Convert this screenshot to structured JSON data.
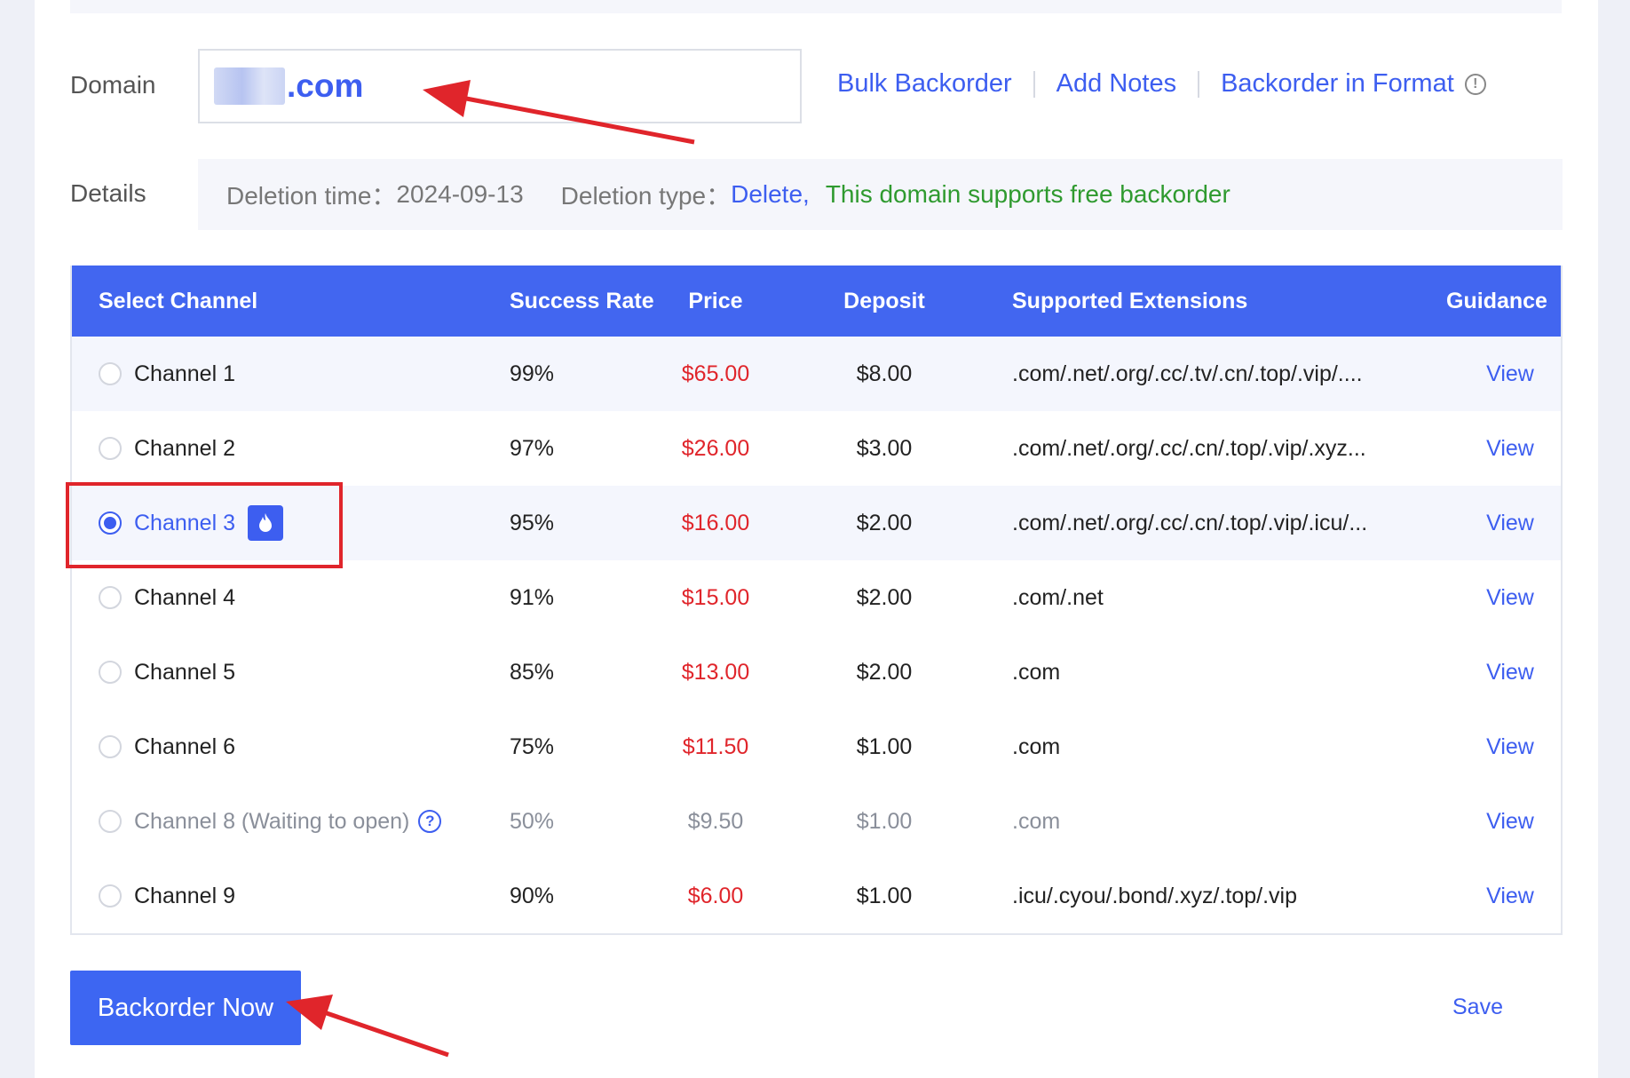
{
  "form": {
    "domain_label": "Domain",
    "domain_ext": ".com",
    "details_label": "Details",
    "links": [
      "Bulk Backorder",
      "Add Notes",
      "Backorder in Format"
    ]
  },
  "details": {
    "deletion_time_label": "Deletion time：",
    "deletion_time": "2024-09-13",
    "deletion_type_label": "Deletion type：",
    "deletion_type": "Delete,",
    "free_note": "This domain supports free backorder"
  },
  "table": {
    "headers": {
      "channel": "Select Channel",
      "success": "Success Rate",
      "price": "Price",
      "deposit": "Deposit",
      "extensions": "Supported Extensions",
      "guidance": "Guidance"
    },
    "rows": [
      {
        "channel": "Channel 1",
        "success": "99%",
        "price": "$65.00",
        "deposit": "$8.00",
        "extensions": ".com/.net/.org/.cc/.tv/.cn/.top/.vip/....",
        "guidance": "View"
      },
      {
        "channel": "Channel 2",
        "success": "97%",
        "price": "$26.00",
        "deposit": "$3.00",
        "extensions": ".com/.net/.org/.cc/.cn/.top/.vip/.xyz...",
        "guidance": "View"
      },
      {
        "channel": "Channel 3",
        "success": "95%",
        "price": "$16.00",
        "deposit": "$2.00",
        "extensions": ".com/.net/.org/.cc/.cn/.top/.vip/.icu/...",
        "guidance": "View",
        "selected": true
      },
      {
        "channel": "Channel 4",
        "success": "91%",
        "price": "$15.00",
        "deposit": "$2.00",
        "extensions": ".com/.net",
        "guidance": "View"
      },
      {
        "channel": "Channel 5",
        "success": "85%",
        "price": "$13.00",
        "deposit": "$2.00",
        "extensions": ".com",
        "guidance": "View"
      },
      {
        "channel": "Channel 6",
        "success": "75%",
        "price": "$11.50",
        "deposit": "$1.00",
        "extensions": ".com",
        "guidance": "View"
      },
      {
        "channel": "Channel 8 (Waiting to open)",
        "success": "50%",
        "price": "$9.50",
        "deposit": "$1.00",
        "extensions": ".com",
        "guidance": "View",
        "disabled": true
      },
      {
        "channel": "Channel 9",
        "success": "90%",
        "price": "$6.00",
        "deposit": "$1.00",
        "extensions": ".icu/.cyou/.bond/.xyz/.top/.vip",
        "guidance": "View"
      }
    ]
  },
  "actions": {
    "primary": "Backorder Now",
    "save": "Save"
  },
  "colors": {
    "accent": "#3d5ef0",
    "header_bg": "#4266f0",
    "price": "#e0252b",
    "success_text": "#2f9a2f",
    "annotation": "#e0252b"
  },
  "icons": [
    "info-icon",
    "fire-icon",
    "question-icon",
    "annotation-arrow"
  ]
}
